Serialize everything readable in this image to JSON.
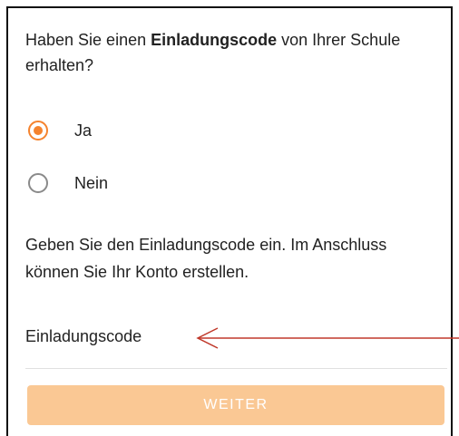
{
  "question": {
    "prefix": "Haben Sie einen ",
    "bold": "Einladungscode",
    "suffix": " von Ihrer Schule erhalten?"
  },
  "options": [
    {
      "label": "Ja",
      "selected": true
    },
    {
      "label": "Nein",
      "selected": false
    }
  ],
  "info_text": "Geben Sie den Einladungscode ein. Im Anschluss können Sie Ihr Konto erstellen.",
  "code_input": {
    "label": "Einladungscode",
    "value": ""
  },
  "button": {
    "label": "WEITER",
    "enabled": false
  },
  "colors": {
    "accent": "#f5832e",
    "button_disabled": "#fac894",
    "annotation_arrow": "#c0392b"
  }
}
